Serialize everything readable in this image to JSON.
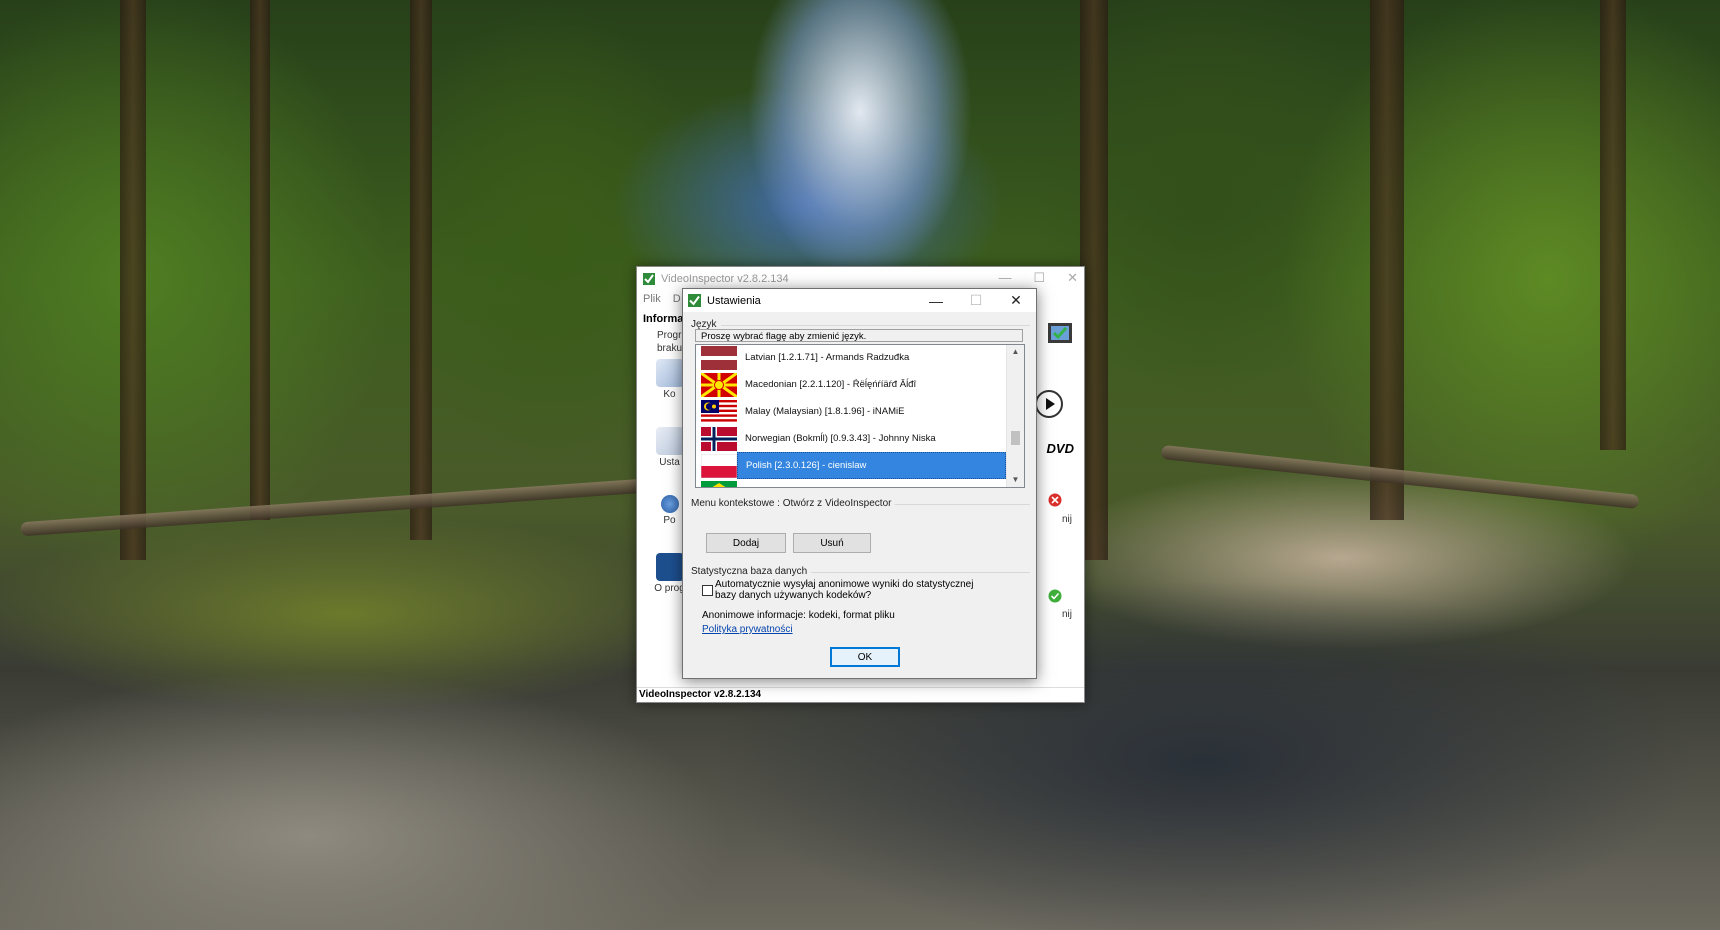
{
  "main_window": {
    "title": "VideoInspector v2.8.2.134",
    "menu": [
      "Plik",
      "D"
    ],
    "info_tab": "Informa",
    "info_lines": [
      "Progra",
      "braku"
    ],
    "side_buttons": [
      "Ko",
      "Usta",
      "Po",
      "O prog"
    ],
    "right_texts": [
      "nij",
      "nij"
    ],
    "dvd_label": "DVD",
    "status": "VideoInspector v2.8.2.134"
  },
  "dialog": {
    "title": "Ustawienia",
    "language": {
      "group_label": "Język",
      "hint": "Proszę wybrać flagę aby zmienić język.",
      "items": [
        {
          "label": "Latvian [1.2.1.71] - Armands Radzuđka",
          "flag": "latvia-flag-icon"
        },
        {
          "label": "Macedonian [2.2.1.120] - Ŕëĺęńŕíäŕđ Ăĺđî",
          "flag": "macedonia-flag-icon"
        },
        {
          "label": "Malay (Malaysian) [1.8.1.96] - iNAMiE",
          "flag": "malaysia-flag-icon"
        },
        {
          "label": "Norwegian (Bokmĺl) [0.9.3.43] - Johnny Niska",
          "flag": "norway-flag-icon"
        },
        {
          "label": "Polish [2.3.0.126] - cienislaw",
          "flag": "poland-flag-icon",
          "selected": true
        }
      ]
    },
    "context_menu": {
      "group_label": "Menu kontekstowe : Otwórz z VideoInspector",
      "add_label": "Dodaj",
      "remove_label": "Usuń"
    },
    "stats": {
      "group_label": "Statystyczna baza danych",
      "checkbox_label": "Automatycznie wysyłaj anonimowe wyniki do statystycznej bazy danych używanych kodeków?",
      "checked": false,
      "anon_info": "Anonimowe informacje: kodeki, format pliku",
      "privacy_link": "Polityka prywatności"
    },
    "ok_label": "OK"
  },
  "colors": {
    "selection": "#3385e0",
    "link": "#0645ad",
    "default_button_border": "#0078d7"
  }
}
